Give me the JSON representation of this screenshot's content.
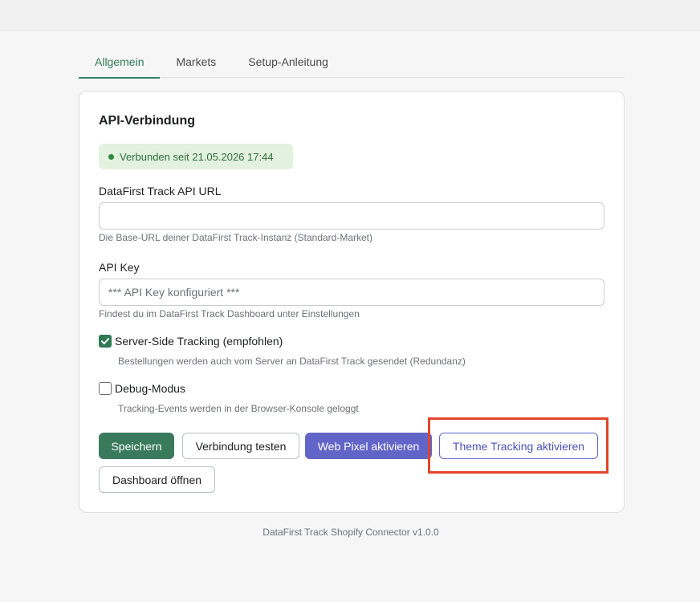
{
  "tabs": [
    {
      "label": "Allgemein",
      "active": true
    },
    {
      "label": "Markets",
      "active": false
    },
    {
      "label": "Setup-Anleitung",
      "active": false
    }
  ],
  "card": {
    "title": "API-Verbindung",
    "status": {
      "text": "Verbunden seit 21.05.2026 17:44",
      "color": "#2e6e3a"
    },
    "api_url": {
      "label": "DataFirst Track API URL",
      "value": "",
      "placeholder": "",
      "help": "Die Base-URL deiner DataFirst Track-Instanz (Standard-Market)"
    },
    "api_key": {
      "label": "API Key",
      "value": "",
      "placeholder": "*** API Key konfiguriert ***",
      "help": "Findest du im DataFirst Track Dashboard unter Einstellungen"
    },
    "server_side": {
      "label": "Server-Side Tracking (empfohlen)",
      "checked": true,
      "help": "Bestellungen werden auch vom Server an DataFirst Track gesendet (Redundanz)"
    },
    "debug": {
      "label": "Debug-Modus",
      "checked": false,
      "help": "Tracking-Events werden in der Browser-Konsole geloggt"
    },
    "buttons": {
      "save": "Speichern",
      "test": "Verbindung testen",
      "web_pixel": "Web Pixel aktivieren",
      "theme_tracking": "Theme Tracking aktivieren",
      "dashboard": "Dashboard öffnen"
    }
  },
  "footer": {
    "text": "DataFirst Track Shopify Connector v1.0.0"
  },
  "colors": {
    "accent": "#3a7a5c",
    "purple": "#6165c8",
    "highlight": "#e0452b"
  }
}
